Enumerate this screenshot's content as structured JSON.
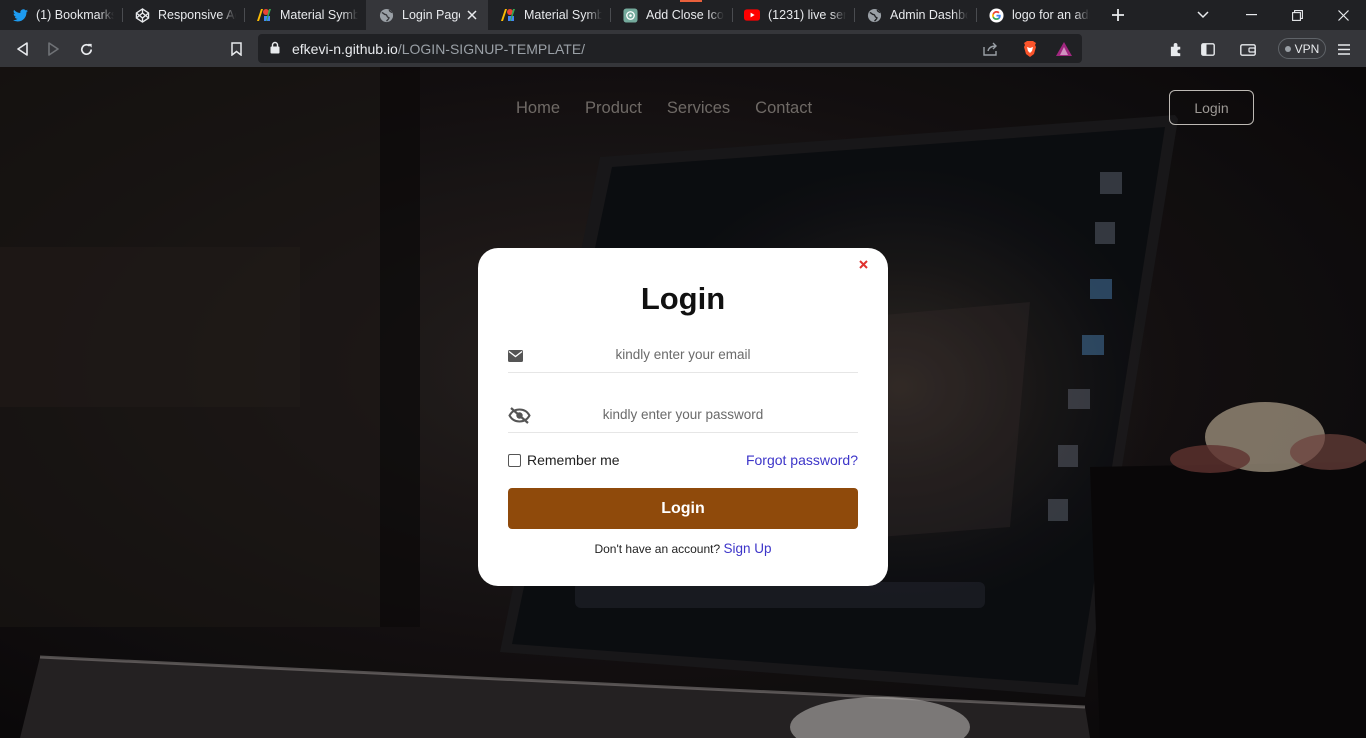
{
  "browser": {
    "tabs": [
      {
        "title": "(1) Bookmarks /",
        "icon": "twitter-icon"
      },
      {
        "title": "Responsive Adm",
        "icon": "codepen-icon"
      },
      {
        "title": "Material Symbol",
        "icon": "google-fonts-icon"
      },
      {
        "title": "Login Page",
        "icon": "globe-icon",
        "active": true
      },
      {
        "title": "Material Symbol",
        "icon": "google-fonts-icon"
      },
      {
        "title": "Add Close Icon",
        "icon": "chatgpt-icon"
      },
      {
        "title": "(1231) live serve",
        "icon": "youtube-icon"
      },
      {
        "title": "Admin Dashboa",
        "icon": "globe-icon"
      },
      {
        "title": "logo for an adm",
        "icon": "google-icon"
      }
    ],
    "address": {
      "host": "efkevi-n.github.io",
      "path": "/LOGIN-SIGNUP-TEMPLATE/"
    },
    "vpn_label": "VPN"
  },
  "nav": {
    "links": [
      "Home",
      "Product",
      "Services",
      "Contact"
    ],
    "login_label": "Login"
  },
  "login": {
    "title": "Login",
    "email_placeholder": "kindly enter your email",
    "password_placeholder": "kindly enter your password",
    "remember_label": "Remember me",
    "forgot_label": "Forgot password?",
    "submit_label": "Login",
    "signup_prompt": "Don't have an account?",
    "signup_link": "Sign Up"
  },
  "colors": {
    "submit_button": "#8f4a0b",
    "link": "#3d35c9",
    "close": "#e0322f"
  }
}
